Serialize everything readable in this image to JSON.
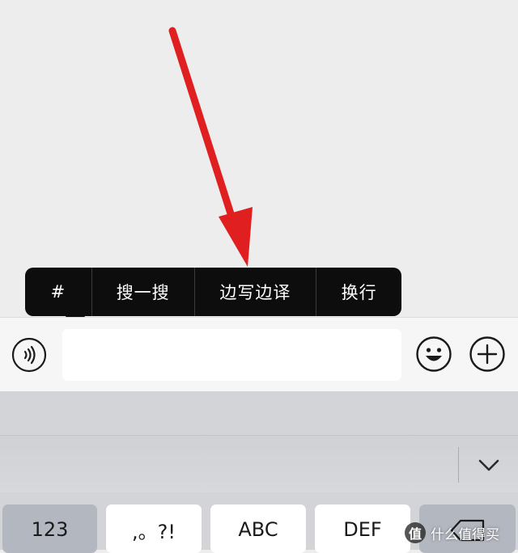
{
  "context_menu": {
    "items": [
      "#",
      "搜一搜",
      "边写边译",
      "换行"
    ]
  },
  "input_bar": {
    "text_value": "",
    "voice_icon": "voice-input-icon",
    "emoji_icon": "emoji-icon",
    "more_icon": "plus-circle-icon"
  },
  "keyboard": {
    "collapse_icon": "chevron-down-icon",
    "keys": [
      "123",
      ",。?!",
      "ABC",
      "DEF"
    ],
    "backspace_icon": "backspace-icon"
  },
  "annotation": {
    "arrow_color": "#e02020"
  },
  "watermark": {
    "badge": "值",
    "text": "什么值得买"
  }
}
